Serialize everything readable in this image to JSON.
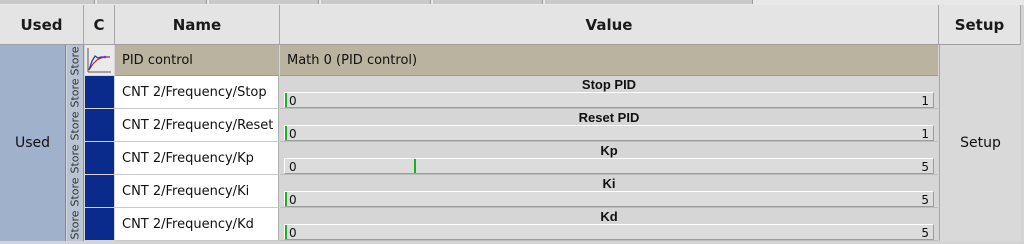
{
  "header": {
    "used": "Used",
    "c": "C",
    "name": "Name",
    "value": "Value",
    "setup": "Setup"
  },
  "used_label": "Used",
  "setup_label": "Setup",
  "store_label": "Store",
  "rows": [
    {
      "name": "PID control",
      "value": "Math 0 (PID control)"
    },
    {
      "name": "CNT 2/Frequency/Stop",
      "title": "Stop PID",
      "min": "0",
      "max": "1",
      "current": 0
    },
    {
      "name": "CNT 2/Frequency/Reset",
      "title": "Reset PID",
      "min": "0",
      "max": "1",
      "current": 0
    },
    {
      "name": "CNT 2/Frequency/Kp",
      "title": "Kp",
      "min": "0",
      "max": "5",
      "current": 1
    },
    {
      "name": "CNT 2/Frequency/Ki",
      "title": "Ki",
      "min": "0",
      "max": "5",
      "current": 0
    },
    {
      "name": "CNT 2/Frequency/Kd",
      "title": "Kd",
      "min": "0",
      "max": "5",
      "current": 0
    }
  ],
  "colors": {
    "used_bg": "#9fb1cb",
    "channel": "#0a2a8c",
    "indicator": "#19b419",
    "pid_row": "#b9b39f"
  }
}
